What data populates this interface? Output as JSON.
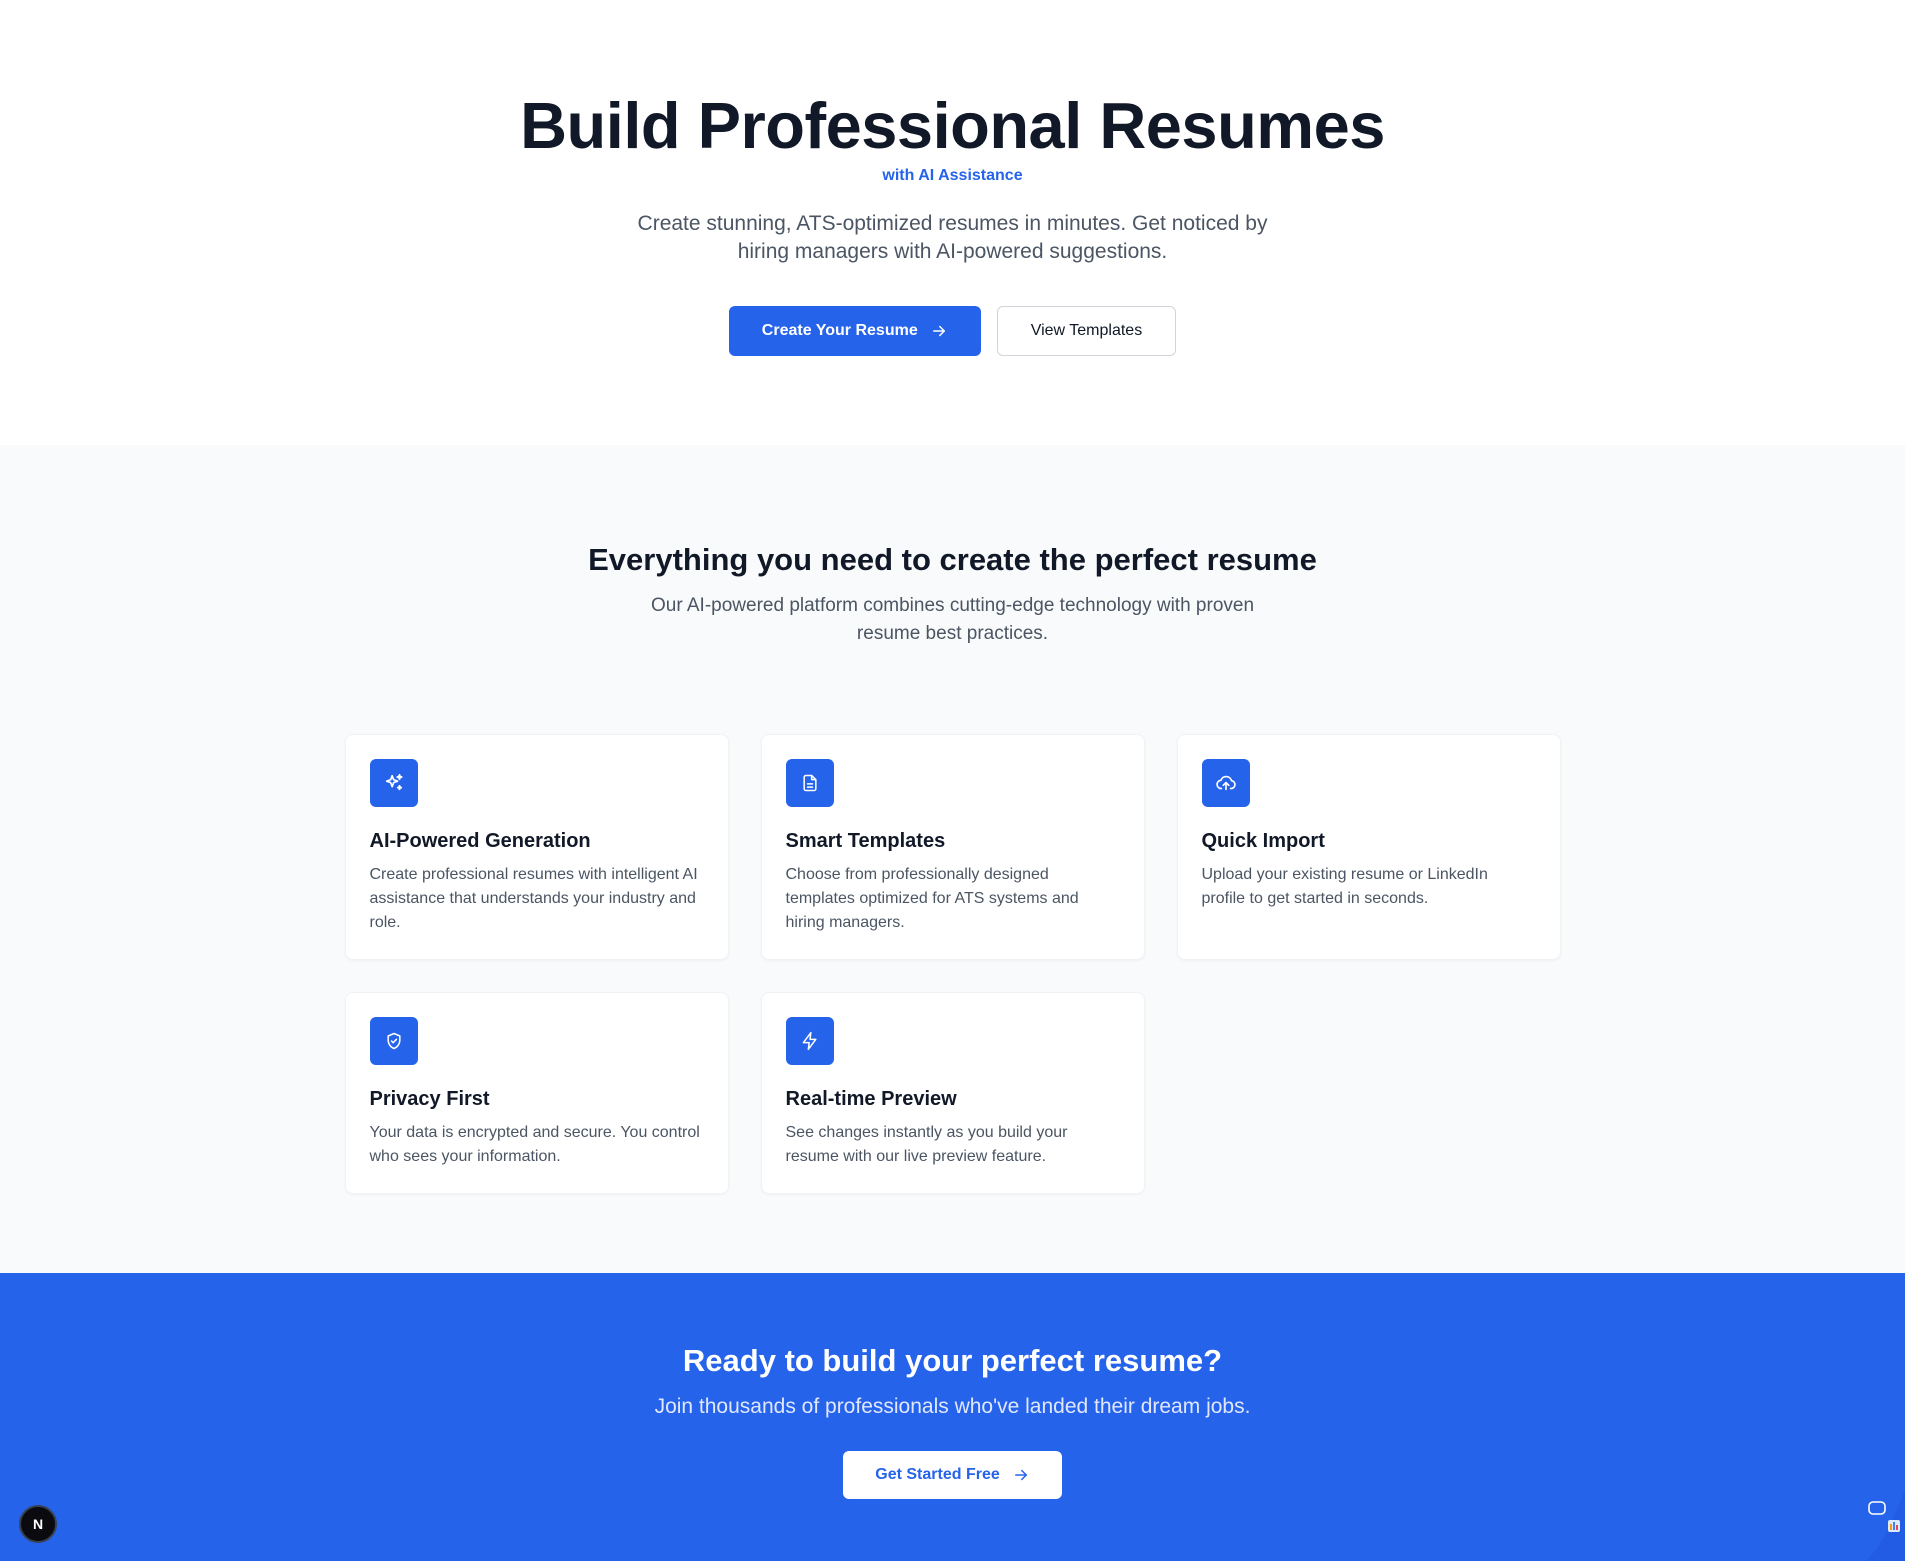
{
  "hero": {
    "title": "Build Professional Resumes",
    "tagline": "with AI Assistance",
    "subtitle": "Create stunning, ATS-optimized resumes in minutes. Get noticed by hiring managers with AI-powered suggestions.",
    "primary_button": "Create Your Resume",
    "secondary_button": "View Templates"
  },
  "features": {
    "title": "Everything you need to create the perfect resume",
    "subtitle": "Our AI-powered platform combines cutting-edge technology with proven resume best practices.",
    "items": [
      {
        "icon": "sparkles-icon",
        "title": "AI-Powered Generation",
        "description": "Create professional resumes with intelligent AI assistance that understands your industry and role."
      },
      {
        "icon": "document-icon",
        "title": "Smart Templates",
        "description": "Choose from professionally designed templates optimized for ATS systems and hiring managers."
      },
      {
        "icon": "cloud-upload-icon",
        "title": "Quick Import",
        "description": "Upload your existing resume or LinkedIn profile to get started in seconds."
      },
      {
        "icon": "shield-check-icon",
        "title": "Privacy First",
        "description": "Your data is encrypted and secure. You control who sees your information."
      },
      {
        "icon": "lightning-icon",
        "title": "Real-time Preview",
        "description": "See changes instantly as you build your resume with our live preview feature."
      }
    ]
  },
  "cta": {
    "title": "Ready to build your perfect resume?",
    "subtitle": "Join thousands of professionals who've landed their dream jobs.",
    "button": "Get Started Free"
  },
  "dev_badge": "N",
  "colors": {
    "accent": "#2563eb",
    "heading": "#111827",
    "body": "#4b5563",
    "section_bg": "#f9fafb"
  }
}
